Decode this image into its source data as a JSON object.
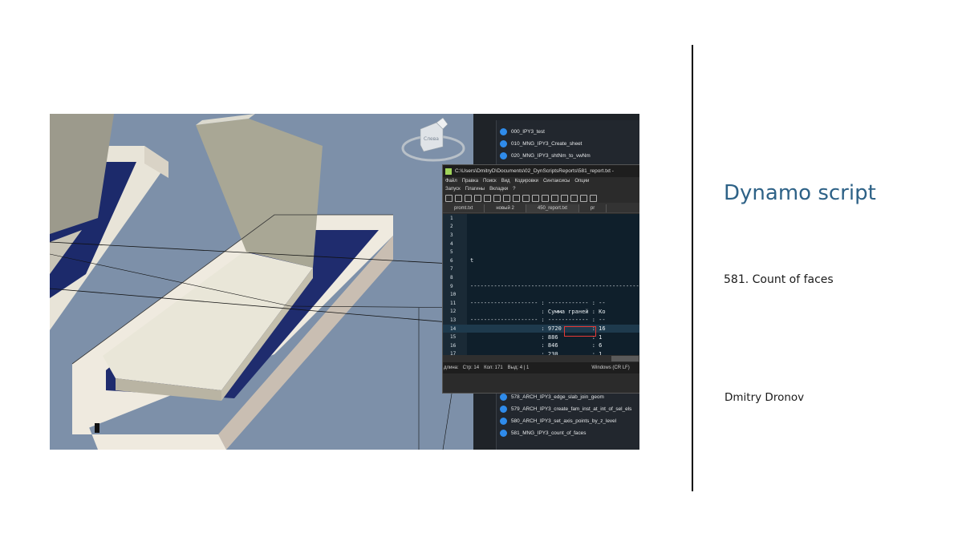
{
  "slide": {
    "title": "Dynamo script",
    "subtitle": "581. Count of faces",
    "author": "Dmitry Dronov"
  },
  "viewport": {
    "viewcube_label": "Слева"
  },
  "script_list": {
    "items_top": [
      "000_IPY3_test",
      "010_MNG_IPY3_Create_sheet",
      "020_MNG_IPY3_shtNm_to_vwNm"
    ],
    "items_bottom": [
      "578_ARCH_IPY3_edge_slab_join_geom",
      "579_ARCH_IPY3_create_fam_inst_at_int_of_sel_els",
      "580_ARCH_IPY3_set_axis_points_by_z_level",
      "581_MNG_IPY3_count_of_faces"
    ]
  },
  "notepad": {
    "title": "C:\\Users\\DmitryD\\Documents\\02_DynScriptsReports\\581_report.txt -",
    "menu_row1": [
      "Файл",
      "Правка",
      "Поиск",
      "Вид",
      "Кодировки",
      "Синтаксисы",
      "Опции"
    ],
    "menu_row2": [
      "Запуск",
      "Плагины",
      "Вкладки",
      "?"
    ],
    "tabs": [
      "promt.txt",
      "новый 2",
      "450_report.txt",
      "pr"
    ],
    "lines": [
      {
        "n": "1",
        "text": ""
      },
      {
        "n": "2",
        "text": ""
      },
      {
        "n": "3",
        "text": ""
      },
      {
        "n": "4",
        "text": ""
      },
      {
        "n": "5",
        "text": ""
      },
      {
        "n": "6",
        "text": "t"
      },
      {
        "n": "7",
        "text": ""
      },
      {
        "n": "8",
        "text": ""
      },
      {
        "n": "9",
        "text": "----------------------------------------------------"
      },
      {
        "n": "10",
        "text": ""
      },
      {
        "n": "11",
        "text": "-------------------- : ------------ : --"
      },
      {
        "n": "12",
        "text": "                     : Сумма граней : Ко"
      },
      {
        "n": "13",
        "text": "-------------------- : ------------ : --"
      },
      {
        "n": "14",
        "text": "                     : 9720         : 16"
      },
      {
        "n": "15",
        "text": "                     : 886          : 1"
      },
      {
        "n": "16",
        "text": "                     : 846          : 6"
      },
      {
        "n": "17",
        "text": "                     : 230          : 1"
      }
    ],
    "status": {
      "length": "длина:",
      "line": "Стр: 14",
      "col": "Кол: 171",
      "sel": "Выд: 4 | 1",
      "eol": "Windows (CR LF)"
    }
  }
}
